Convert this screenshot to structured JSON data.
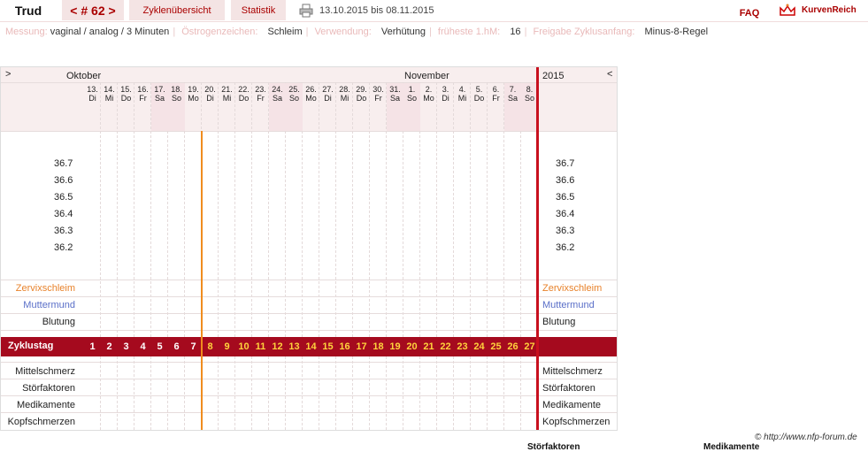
{
  "header": {
    "user": "Trud",
    "cycle_nav": "< # 62 >",
    "tab_overview": "Zyklenübersicht",
    "tab_stats": "Statistik",
    "date_range": "13.10.2015 bis 08.11.2015",
    "faq": "FAQ",
    "brand": "KurvenReich"
  },
  "info": [
    {
      "key": "Messung:",
      "value": "vaginal / analog / 3 Minuten"
    },
    {
      "key": "Östrogenzeichen:",
      "value": "Schleim"
    },
    {
      "key": "Verwendung:",
      "value": "Verhütung"
    },
    {
      "key": "früheste 1.hM:",
      "value": "16"
    },
    {
      "key": "Freigabe Zyklusanfang:",
      "value": "Minus-8-Regel"
    }
  ],
  "chart": {
    "nav_left": ">",
    "nav_right": "<",
    "month1": "Oktober",
    "month2": "November",
    "year": "2015",
    "temps": [
      "36.7",
      "36.6",
      "36.5",
      "36.4",
      "36.3",
      "36.2"
    ],
    "obs_rows": [
      "Zervixschleim",
      "Muttermund",
      "Blutung"
    ],
    "obs_colors": [
      "#e8822b",
      "#5a6fc8",
      "#222222"
    ],
    "cycle_label": "Zyklustag",
    "symptom_rows": [
      "Mittelschmerz",
      "Störfaktoren",
      "Medikamente",
      "Kopfschmerzen"
    ],
    "days": [
      {
        "d": "13.",
        "w": "Di"
      },
      {
        "d": "14.",
        "w": "Mi"
      },
      {
        "d": "15.",
        "w": "Do"
      },
      {
        "d": "16.",
        "w": "Fr"
      },
      {
        "d": "17.",
        "w": "Sa"
      },
      {
        "d": "18.",
        "w": "So"
      },
      {
        "d": "19.",
        "w": "Mo"
      },
      {
        "d": "20.",
        "w": "Di"
      },
      {
        "d": "21.",
        "w": "Mi"
      },
      {
        "d": "22.",
        "w": "Do"
      },
      {
        "d": "23.",
        "w": "Fr"
      },
      {
        "d": "24.",
        "w": "Sa"
      },
      {
        "d": "25.",
        "w": "So"
      },
      {
        "d": "26.",
        "w": "Mo"
      },
      {
        "d": "27.",
        "w": "Di"
      },
      {
        "d": "28.",
        "w": "Mi"
      },
      {
        "d": "29.",
        "w": "Do"
      },
      {
        "d": "30.",
        "w": "Fr"
      },
      {
        "d": "31.",
        "w": "Sa"
      },
      {
        "d": "1.",
        "w": "So"
      },
      {
        "d": "2.",
        "w": "Mo"
      },
      {
        "d": "3.",
        "w": "Di"
      },
      {
        "d": "4.",
        "w": "Mi"
      },
      {
        "d": "5.",
        "w": "Do"
      },
      {
        "d": "6.",
        "w": "Fr"
      },
      {
        "d": "7.",
        "w": "Sa"
      },
      {
        "d": "8.",
        "w": "So"
      }
    ],
    "cycle_days": [
      "1",
      "2",
      "3",
      "4",
      "5",
      "6",
      "7",
      "8",
      "9",
      "10",
      "11",
      "12",
      "13",
      "14",
      "15",
      "16",
      "17",
      "18",
      "19",
      "20",
      "21",
      "22",
      "23",
      "24",
      "25",
      "26",
      "27"
    ],
    "colors": {
      "accent": "#a50a1e",
      "orange_line": "#f08c1e",
      "weekend": "#f5e3e6",
      "cycle_num_light": "#ffd23c"
    }
  },
  "footer": {
    "copyright": "© http://www.nfp-forum.de",
    "cut1": "Störfaktoren",
    "cut2": "Medikamente"
  }
}
